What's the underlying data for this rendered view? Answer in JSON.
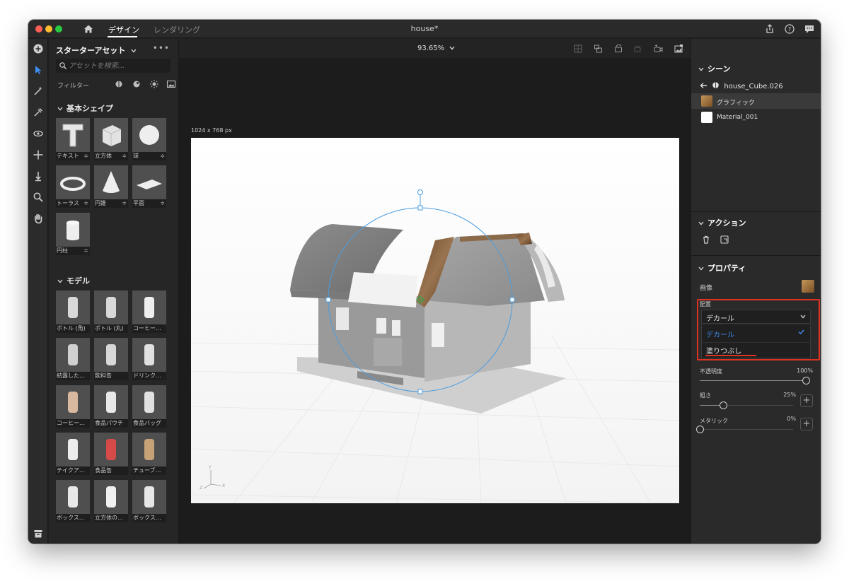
{
  "titlebar": {
    "tabs": [
      "デザイン",
      "レンダリング"
    ],
    "document_title": "house*"
  },
  "toolbar": {
    "tools": [
      "add-icon",
      "select-icon",
      "magic-wand-icon",
      "sampler-icon",
      "orbit-icon",
      "pan-icon",
      "dolly-icon",
      "zoom-icon",
      "hand-icon"
    ]
  },
  "left_panel": {
    "header": "スターターアセット",
    "more_label": "•••",
    "search_placeholder": "アセットを検索...",
    "filter_label": "フィルター",
    "basic_section": "基本シェイプ",
    "basic_items": [
      {
        "label": "テキスト",
        "has_settings": true
      },
      {
        "label": "立方体",
        "has_settings": true
      },
      {
        "label": "球",
        "has_settings": true
      },
      {
        "label": "トーラス",
        "has_settings": true
      },
      {
        "label": "円錐",
        "has_settings": true
      },
      {
        "label": "平面",
        "has_settings": true
      },
      {
        "label": "円柱",
        "has_settings": true
      }
    ],
    "models_section": "モデル",
    "model_items": [
      {
        "label": "ボトル (角)"
      },
      {
        "label": "ボトル (丸)"
      },
      {
        "label": "コーヒー…"
      },
      {
        "label": "結露した…"
      },
      {
        "label": "飲料缶"
      },
      {
        "label": "ドリンク…"
      },
      {
        "label": "コーヒー…"
      },
      {
        "label": "食品パウチ"
      },
      {
        "label": "食品バッグ"
      },
      {
        "label": "テイクア…"
      },
      {
        "label": "食品缶"
      },
      {
        "label": "チューブ…"
      },
      {
        "label": "ボックス…"
      },
      {
        "label": "立方体の…"
      },
      {
        "label": "ボックス…"
      }
    ],
    "settings_glyph": "≑"
  },
  "canvas": {
    "zoom": "93.65%",
    "size_label": "1024 x 768 px",
    "axis_labels": {
      "y": "Y",
      "z": "Z",
      "x": "X"
    }
  },
  "right_panel": {
    "scene_section": "シーン",
    "scene_parent": "house_Cube.026",
    "materials": [
      {
        "label": "グラフィック",
        "selected": true
      },
      {
        "label": "Material_001",
        "selected": false
      }
    ],
    "actions_section": "アクション",
    "properties_section": "プロパティ",
    "image_label": "画像",
    "placement_label": "配置",
    "placement_value": "デカール",
    "placement_options": [
      "デカール",
      "塗りつぶし"
    ],
    "opacity_label": "不透明度",
    "opacity_value": "100%",
    "opacity": 1.0,
    "roughness_label": "粗さ",
    "roughness_value": "25%",
    "roughness": 0.25,
    "metallic_label": "メタリック",
    "metallic_value": "0%",
    "metallic": 0.0,
    "plus_label": "+"
  },
  "colors": {
    "accent": "#3f8ef5",
    "highlight": "#e03222",
    "gizmo": "#4a9de0"
  }
}
